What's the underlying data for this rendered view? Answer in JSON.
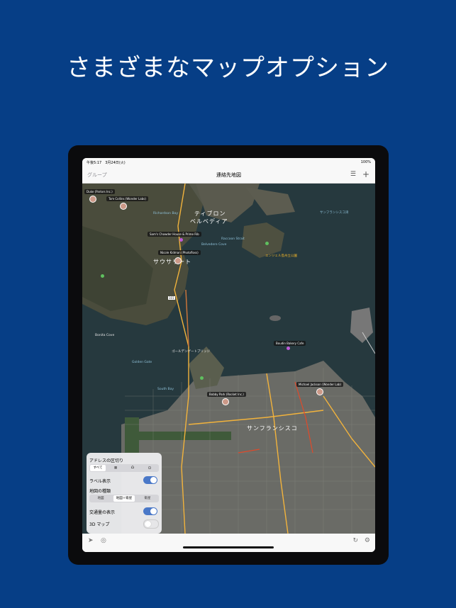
{
  "headline": "さまざまなマップオプション",
  "status": {
    "left": "午後5:17　3月24日(火)",
    "right": "100%"
  },
  "nav": {
    "back": "グループ",
    "title": "連絡先地図"
  },
  "map": {
    "labels": {
      "sausalito": "サウサリート",
      "tiburon": "ティブロン",
      "belvedere": "ベルベディア",
      "sf_big": "サンフランシスコ",
      "sf_bay": "サンフランシスコ湾",
      "richardson": "Richardson Bay",
      "belvedere_cove": "Belvedere Cove",
      "raccoon": "Raccoon Strait",
      "angel": "エンジェル島州立公園",
      "bonita": "Bonita Cove",
      "golden": "Golden Gate",
      "gg_bridge": "ゴールデンゲートブリッジ",
      "south_bay": "South Bay"
    },
    "tags": {
      "t1": "Duke (Parlors Inc.)",
      "t2": "Tom Collins (Wonder Labs)",
      "t3": "Sam's Chowder House & Prime Rib",
      "t4": "Nicole Kidman (Photofloss)",
      "t5": "Boudin Bakery Cafe",
      "t6": "Michael Jackson (Wonder Lab)",
      "t7": "Bobby Park (Rocket Inc.)"
    },
    "road_101": "101"
  },
  "panel": {
    "address_section": "アドレスの区切り",
    "all": "すべて",
    "label_display": "ラベル表示",
    "map_type": "地図の種類",
    "map_types": [
      "地図",
      "地図＋衛星",
      "衛星"
    ],
    "traffic": "交通量の表示",
    "map3d": "3D マップ"
  },
  "icons": [
    "location-arrow-icon",
    "globe-icon",
    "refresh-icon",
    "gear-icon",
    "list-icon",
    "plus-icon",
    "building-icon",
    "home-icon",
    "pin-icon"
  ],
  "colors": {
    "background": "#063e86",
    "toggle_on": "#4a78c8"
  }
}
